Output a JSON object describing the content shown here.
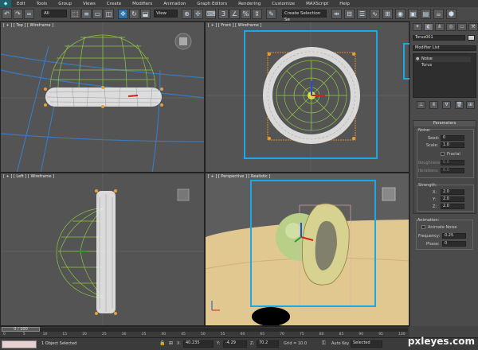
{
  "app": {
    "menu": [
      "Edit",
      "Tools",
      "Group",
      "Views",
      "Create",
      "Modifiers",
      "Animation",
      "Graph Editors",
      "Rendering",
      "Customize",
      "MAXScript",
      "Help"
    ],
    "selection_filter": "All",
    "coord_system": "View",
    "named_selection": "Create Selection Se"
  },
  "viewports": {
    "top": "[ + ] [ Top ] [ Wireframe ]",
    "front": "[ + ] [ Front ] [ Wireframe ]",
    "left": "[ + ] [ Left ] [ Wireframe ]",
    "perspective": "[ + ] [ Perspective ] [ Realistic ]"
  },
  "command_panel": {
    "object_name": "Torus001",
    "modifier_list_label": "Modifier List",
    "stack": [
      "Noise",
      "Torus"
    ],
    "parameters": {
      "title": "Parameters",
      "noise_group": "Noise:",
      "seed_label": "Seed:",
      "seed": "0",
      "scale_label": "Scale:",
      "scale": "1.0",
      "fractal_label": "Fractal",
      "roughness_label": "Roughness:",
      "roughness": "0.0",
      "iterations_label": "Iterations:",
      "iterations": "6.0",
      "strength_group": "Strength:",
      "x_label": "X:",
      "x": "2.0",
      "y_label": "Y:",
      "y": "2.0",
      "z_label": "Z:",
      "z": "2.0"
    },
    "animation": {
      "title": "Animation:",
      "animate_noise_label": "Animate Noise",
      "frequency_label": "Frequency:",
      "frequency": "0.25",
      "phase_label": "Phase:",
      "phase": "0"
    }
  },
  "timeline": {
    "frame_label": "0 / 100",
    "ticks": [
      "0",
      "5",
      "10",
      "15",
      "20",
      "25",
      "30",
      "35",
      "40",
      "45",
      "50",
      "55",
      "60",
      "65",
      "70",
      "75",
      "80",
      "85",
      "90",
      "95",
      "100"
    ]
  },
  "status": {
    "selected": "1 Object Selected",
    "x_label": "X:",
    "x": "40.235",
    "y_label": "Y:",
    "y": "-4.29",
    "z_label": "Z:",
    "z": "70.2",
    "grid": "Grid = 10.0",
    "auto_key": "Auto Key",
    "selected_dropdown": "Selected"
  },
  "watermark": "pxleyes.com"
}
